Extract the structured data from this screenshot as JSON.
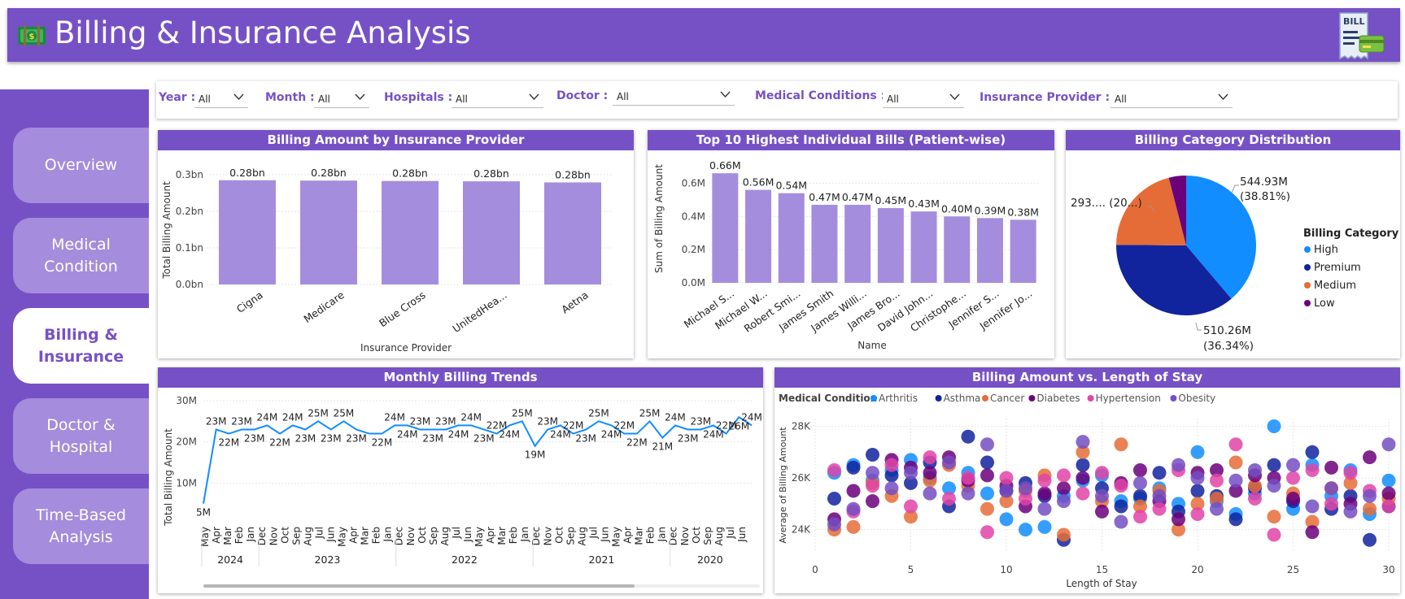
{
  "header": {
    "title": "Billing & Insurance Analysis",
    "logo_icon": "money-icon",
    "corner_icon": "bill-receipt-icon",
    "bill_text": "BILL"
  },
  "sidebar": {
    "items": [
      {
        "label": "Overview",
        "active": false
      },
      {
        "label": "Medical\nCondition",
        "active": false
      },
      {
        "label": "Billing &\nInsurance",
        "active": true
      },
      {
        "label": "Doctor &\nHospital",
        "active": false
      },
      {
        "label": "Time-Based\nAnalysis",
        "active": false
      }
    ]
  },
  "filters": {
    "year": {
      "label": "Year :",
      "value": "All"
    },
    "month": {
      "label": "Month :",
      "value": "All"
    },
    "hospitals": {
      "label": "Hospitals :",
      "value": "All"
    },
    "doctor": {
      "label": "Doctor :",
      "value": "All"
    },
    "conditions": {
      "label": "Medical Conditions :",
      "value": "All"
    },
    "insurance": {
      "label": "Insurance Provider :",
      "value": "All"
    }
  },
  "colors": {
    "accent": "#7651c6",
    "bar": "#a58ddd",
    "line": "#118dff"
  },
  "chart_data": [
    {
      "id": "insurance",
      "type": "bar",
      "title": "Billing Amount by Insurance Provider",
      "xlabel": "Insurance Provider",
      "ylabel": "Total Billing Amount",
      "categories": [
        "Cigna",
        "Medicare",
        "Blue Cross",
        "UnitedHea...",
        "Aetna"
      ],
      "values": [
        0.285,
        0.284,
        0.283,
        0.282,
        0.279
      ],
      "data_labels": [
        "0.28bn",
        "0.28bn",
        "0.28bn",
        "0.28bn",
        "0.28bn"
      ],
      "yticks": [
        "0.0bn",
        "0.1bn",
        "0.2bn",
        "0.3bn"
      ],
      "ylim": [
        0,
        0.3
      ]
    },
    {
      "id": "top10",
      "type": "bar",
      "title": "Top 10 Highest Individual Bills (Patient-wise)",
      "xlabel": "Name",
      "ylabel": "Sum of Billing Amount",
      "categories": [
        "Michael S...",
        "Michael W...",
        "Robert Smi...",
        "James Smith",
        "James Willi...",
        "James Bro...",
        "David John...",
        "Christophe...",
        "Jennifer S...",
        "Jennifer Jo..."
      ],
      "values": [
        0.66,
        0.56,
        0.54,
        0.47,
        0.47,
        0.45,
        0.43,
        0.4,
        0.39,
        0.38
      ],
      "data_labels": [
        "0.66M",
        "0.56M",
        "0.54M",
        "0.47M",
        "0.47M",
        "0.45M",
        "0.43M",
        "0.40M",
        "0.39M",
        "0.38M"
      ],
      "yticks": [
        "0.0M",
        "0.2M",
        "0.4M",
        "0.6M"
      ],
      "ylim": [
        0,
        0.7
      ]
    },
    {
      "id": "category",
      "type": "pie",
      "title": "Billing Category Distribution",
      "legend_title": "Billing Category",
      "legend_position": "right",
      "slices": [
        {
          "name": "High",
          "value": 38.81,
          "color": "#118dff"
        },
        {
          "name": "Premium",
          "value": 36.34,
          "color": "#12239e"
        },
        {
          "name": "Medium",
          "value": 20.85,
          "color": "#e66c37"
        },
        {
          "name": "Low",
          "value": 4.0,
          "color": "#6b007b"
        }
      ],
      "labels": [
        {
          "text1": "544.93M",
          "text2": "(38.81%)"
        },
        {
          "text1": "510.26M",
          "text2": "(36.34%)"
        },
        {
          "text1": "293.... (20...)",
          "text2": ""
        }
      ]
    },
    {
      "id": "monthly",
      "type": "line",
      "title": "Monthly Billing Trends",
      "ylabel": "Total Billing Amount",
      "yticks": [
        "10M",
        "20M",
        "30M"
      ],
      "ylim": [
        0,
        30
      ],
      "months": [
        "May",
        "Apr",
        "Mar",
        "Feb",
        "Jan",
        "Dec",
        "Nov",
        "Oct",
        "Sep",
        "Aug",
        "Jul",
        "Jun",
        "May",
        "Apr",
        "Mar",
        "Feb",
        "Jan",
        "Dec",
        "Nov",
        "Oct",
        "Sep",
        "Aug",
        "Jul",
        "Jun",
        "May",
        "Apr",
        "Mar",
        "Feb",
        "Jan",
        "Dec",
        "Nov",
        "Oct",
        "Sep",
        "Aug",
        "Jul",
        "Jun",
        "May",
        "Apr",
        "Mar",
        "Feb",
        "Jan",
        "Dec",
        "Nov",
        "Oct",
        "Sep",
        "Aug",
        "Jul",
        "Jun"
      ],
      "values": [
        5,
        23,
        22,
        23,
        23,
        24,
        22,
        24,
        23,
        25,
        23,
        25,
        23,
        22,
        22,
        24,
        24,
        23,
        23,
        23,
        24,
        24,
        23,
        22,
        24,
        25,
        19,
        23,
        24,
        22,
        23,
        25,
        24,
        22,
        22,
        25,
        21,
        24,
        23,
        23,
        24,
        22,
        26,
        24
      ],
      "point_labels": [
        "5M",
        "23M",
        "22M",
        "23M",
        "23M",
        "24M",
        "22M",
        "24M",
        "23M",
        "25M",
        "23M",
        "25M",
        "23M",
        "",
        "22M",
        "24M",
        "24M",
        "23M",
        "23M",
        "23M",
        "24M",
        "24M",
        "23M",
        "22M",
        "24M",
        "25M",
        "19M",
        "23M",
        "24M",
        "22M",
        "23M",
        "25M",
        "24M",
        "22M",
        "22M",
        "25M",
        "21M",
        "24M",
        "23M",
        "23M",
        "24M",
        "22M",
        "26M",
        "24M"
      ],
      "years": [
        {
          "label": "2024",
          "from": 0,
          "to": 4
        },
        {
          "label": "2023",
          "from": 5,
          "to": 16
        },
        {
          "label": "2022",
          "from": 17,
          "to": 28
        },
        {
          "label": "2021",
          "from": 29,
          "to": 40
        },
        {
          "label": "2020",
          "from": 41,
          "to": 47
        }
      ]
    },
    {
      "id": "scatter",
      "type": "scatter",
      "title": "Billing Amount vs. Length of Stay",
      "xlabel": "Length of Stay",
      "ylabel": "Average of Billing Amount",
      "xticks": [
        "0",
        "5",
        "10",
        "15",
        "20",
        "25",
        "30"
      ],
      "yticks": [
        "24K",
        "26K",
        "28K"
      ],
      "xlim": [
        0,
        30
      ],
      "ylim": [
        23.2,
        28.3
      ],
      "legend_title": "Medical Condition",
      "series": [
        {
          "name": "Arthritis",
          "color": "#118dff",
          "points": [
            [
              1,
              26.2
            ],
            [
              2,
              26.5
            ],
            [
              3,
              25.9
            ],
            [
              4,
              26.3
            ],
            [
              5,
              26.7
            ],
            [
              6,
              26.0
            ],
            [
              7,
              25.6
            ],
            [
              8,
              26.2
            ],
            [
              9,
              25.4
            ],
            [
              10,
              24.4
            ],
            [
              11,
              24.0
            ],
            [
              12,
              24.1
            ],
            [
              13,
              25.3
            ],
            [
              14,
              25.9
            ],
            [
              15,
              26.1
            ],
            [
              16,
              25.1
            ],
            [
              17,
              25.2
            ],
            [
              18,
              25.6
            ],
            [
              19,
              25.0
            ],
            [
              20,
              27.0
            ],
            [
              21,
              25.1
            ],
            [
              22,
              24.6
            ],
            [
              23,
              25.4
            ],
            [
              24,
              28.0
            ],
            [
              25,
              24.8
            ],
            [
              26,
              26.5
            ],
            [
              27,
              25.3
            ],
            [
              28,
              26.3
            ],
            [
              29,
              24.6
            ],
            [
              30,
              25.9
            ]
          ]
        },
        {
          "name": "Asthma",
          "color": "#12239e",
          "points": [
            [
              1,
              25.2
            ],
            [
              2,
              26.4
            ],
            [
              3,
              26.9
            ],
            [
              4,
              26.1
            ],
            [
              5,
              25.8
            ],
            [
              6,
              26.6
            ],
            [
              7,
              24.9
            ],
            [
              8,
              27.6
            ],
            [
              9,
              26.6
            ],
            [
              10,
              25.5
            ],
            [
              11,
              25.8
            ],
            [
              12,
              25.3
            ],
            [
              13,
              23.6
            ],
            [
              14,
              26.5
            ],
            [
              15,
              25.6
            ],
            [
              16,
              24.9
            ],
            [
              17,
              25.3
            ],
            [
              18,
              26.2
            ],
            [
              19,
              24.7
            ],
            [
              20,
              25.5
            ],
            [
              21,
              25.3
            ],
            [
              22,
              24.4
            ],
            [
              23,
              25.6
            ],
            [
              24,
              26.5
            ],
            [
              25,
              25.1
            ],
            [
              26,
              27.0
            ],
            [
              27,
              24.8
            ],
            [
              28,
              25.3
            ],
            [
              29,
              23.6
            ],
            [
              30,
              24.9
            ]
          ]
        },
        {
          "name": "Cancer",
          "color": "#e66c37",
          "points": [
            [
              1,
              24.0
            ],
            [
              2,
              24.1
            ],
            [
              3,
              25.8
            ],
            [
              4,
              25.3
            ],
            [
              5,
              24.5
            ],
            [
              6,
              25.9
            ],
            [
              7,
              26.5
            ],
            [
              8,
              25.7
            ],
            [
              9,
              24.8
            ],
            [
              10,
              25.1
            ],
            [
              11,
              25.5
            ],
            [
              12,
              26.1
            ],
            [
              13,
              23.8
            ],
            [
              14,
              27.0
            ],
            [
              15,
              25.1
            ],
            [
              16,
              27.3
            ],
            [
              17,
              24.9
            ],
            [
              18,
              25.5
            ],
            [
              19,
              24.0
            ],
            [
              20,
              25.0
            ],
            [
              21,
              25.2
            ],
            [
              22,
              26.6
            ],
            [
              23,
              25.7
            ],
            [
              24,
              24.5
            ],
            [
              25,
              25.4
            ],
            [
              26,
              24.3
            ],
            [
              27,
              25.6
            ],
            [
              28,
              25.8
            ],
            [
              29,
              24.8
            ],
            [
              30,
              25.2
            ]
          ]
        },
        {
          "name": "Diabetes",
          "color": "#6b007b",
          "points": [
            [
              1,
              24.4
            ],
            [
              2,
              25.5
            ],
            [
              3,
              25.1
            ],
            [
              4,
              26.7
            ],
            [
              5,
              26.4
            ],
            [
              6,
              26.2
            ],
            [
              7,
              26.8
            ],
            [
              8,
              25.9
            ],
            [
              9,
              26.1
            ],
            [
              10,
              25.7
            ],
            [
              11,
              24.9
            ],
            [
              12,
              25.4
            ],
            [
              13,
              25.6
            ],
            [
              14,
              26.0
            ],
            [
              15,
              24.7
            ],
            [
              16,
              25.8
            ],
            [
              17,
              26.3
            ],
            [
              18,
              25.1
            ],
            [
              19,
              24.4
            ],
            [
              20,
              26.2
            ],
            [
              21,
              26.3
            ],
            [
              22,
              25.5
            ],
            [
              23,
              26.1
            ],
            [
              24,
              26.0
            ],
            [
              25,
              25.2
            ],
            [
              26,
              23.9
            ],
            [
              27,
              26.4
            ],
            [
              28,
              25.0
            ],
            [
              29,
              26.8
            ],
            [
              30,
              25.4
            ]
          ]
        },
        {
          "name": "Hypertension",
          "color": "#e044a7",
          "points": [
            [
              1,
              26.3
            ],
            [
              2,
              24.7
            ],
            [
              3,
              25.7
            ],
            [
              4,
              26.5
            ],
            [
              5,
              24.9
            ],
            [
              6,
              26.8
            ],
            [
              7,
              25.2
            ],
            [
              8,
              26.0
            ],
            [
              9,
              23.9
            ],
            [
              10,
              26.0
            ],
            [
              11,
              25.2
            ],
            [
              12,
              25.9
            ],
            [
              13,
              26.1
            ],
            [
              14,
              25.4
            ],
            [
              15,
              26.2
            ],
            [
              16,
              25.7
            ],
            [
              17,
              24.5
            ],
            [
              18,
              24.8
            ],
            [
              19,
              26.3
            ],
            [
              20,
              24.6
            ],
            [
              21,
              25.9
            ],
            [
              22,
              27.3
            ],
            [
              23,
              25.2
            ],
            [
              24,
              23.8
            ],
            [
              25,
              26.0
            ],
            [
              26,
              26.3
            ],
            [
              27,
              25.0
            ],
            [
              28,
              26.2
            ],
            [
              29,
              25.5
            ],
            [
              30,
              24.9
            ]
          ]
        },
        {
          "name": "Obesity",
          "color": "#744ec2",
          "points": [
            [
              1,
              24.2
            ],
            [
              2,
              24.8
            ],
            [
              3,
              26.2
            ],
            [
              4,
              25.6
            ],
            [
              5,
              26.2
            ],
            [
              6,
              25.4
            ],
            [
              7,
              26.6
            ],
            [
              8,
              25.4
            ],
            [
              9,
              27.3
            ],
            [
              10,
              25.5
            ],
            [
              11,
              25.6
            ],
            [
              12,
              24.8
            ],
            [
              13,
              25.1
            ],
            [
              14,
              27.4
            ],
            [
              15,
              25.3
            ],
            [
              16,
              24.3
            ],
            [
              17,
              25.8
            ],
            [
              18,
              25.3
            ],
            [
              19,
              26.5
            ],
            [
              20,
              26.0
            ],
            [
              21,
              24.8
            ],
            [
              22,
              25.9
            ],
            [
              23,
              26.3
            ],
            [
              24,
              25.7
            ],
            [
              25,
              26.5
            ],
            [
              26,
              24.9
            ],
            [
              27,
              25.6
            ],
            [
              28,
              24.7
            ],
            [
              29,
              25.3
            ],
            [
              30,
              27.3
            ]
          ]
        }
      ]
    }
  ]
}
